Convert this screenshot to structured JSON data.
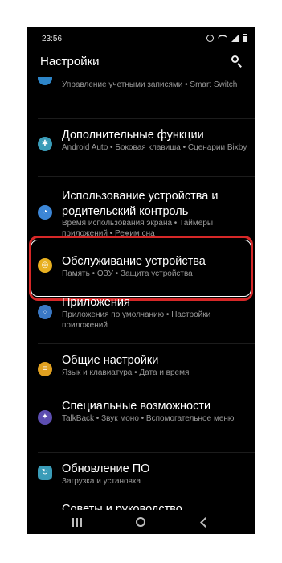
{
  "status_bar": {
    "time": "23:56",
    "icons": [
      "alarm-icon",
      "wifi-icon",
      "signal-icon",
      "battery-icon"
    ]
  },
  "header": {
    "title": "Настройки",
    "search_icon": "search-icon"
  },
  "items": [
    {
      "id": "accounts",
      "title": "",
      "subtitle": "Управление учетными записями • Smart Switch",
      "icon": "accounts-icon",
      "icon_color": "#2e86c9"
    },
    {
      "id": "advanced",
      "title": "Дополнительные функции",
      "subtitle": "Android Auto • Боковая клавиша • Сценарии Bixby",
      "icon": "gear-plus-icon",
      "icon_color": "#3a9cb8"
    },
    {
      "id": "digital-wellbeing",
      "title": "Использование устройства и родительский контроль",
      "subtitle": "Время использования экрана • Таймеры приложений • Режим сна",
      "icon": "wellbeing-icon",
      "icon_color": "#3c86d6"
    },
    {
      "id": "device-care",
      "title": "Обслуживание устройства",
      "subtitle": "Память • ОЗУ • Защита устройства",
      "icon": "device-care-icon",
      "icon_color": "#e8b020"
    },
    {
      "id": "apps",
      "title": "Приложения",
      "subtitle": "Приложения по умолчанию • Настройки приложений",
      "icon": "apps-icon",
      "icon_color": "#3a78c4"
    },
    {
      "id": "general",
      "title": "Общие настройки",
      "subtitle": "Язык и клавиатура • Дата и время",
      "icon": "sliders-icon",
      "icon_color": "#e0a020"
    },
    {
      "id": "accessibility",
      "title": "Специальные возможности",
      "subtitle": "TalkBack • Звук моно • Вспомогательное меню",
      "icon": "accessibility-icon",
      "icon_color": "#5c4db0"
    },
    {
      "id": "software-update",
      "title": "Обновление ПО",
      "subtitle": "Загрузка и установка",
      "icon": "update-icon",
      "icon_color": "#3a9cb8"
    },
    {
      "id": "tips",
      "title": "Советы и руководство",
      "subtitle": "",
      "icon": "",
      "icon_color": ""
    }
  ],
  "highlight_color": "#d62828",
  "nav_bar": {
    "icons": [
      "recent-apps-icon",
      "home-icon",
      "back-icon"
    ]
  }
}
